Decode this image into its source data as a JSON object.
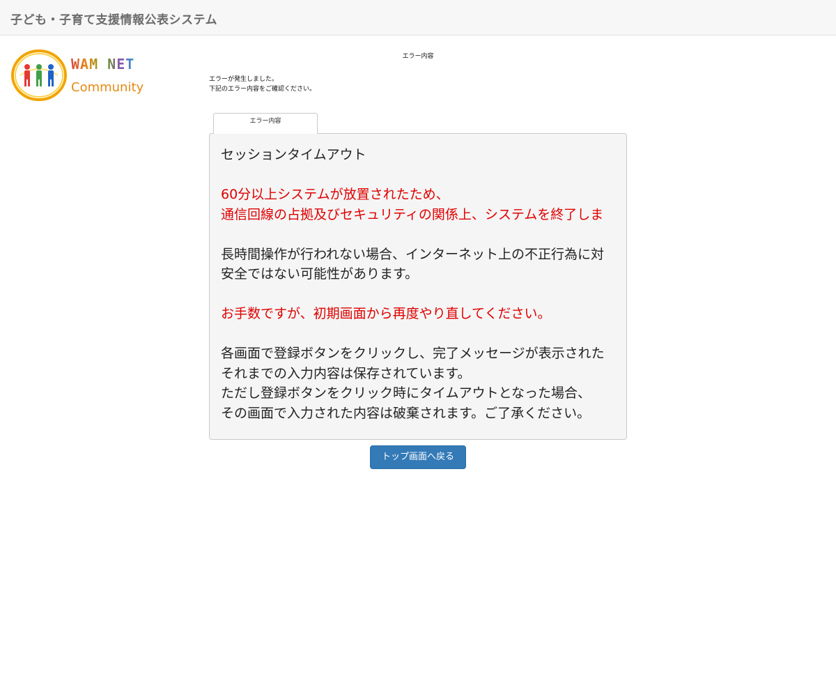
{
  "header": {
    "title": "子ども・子育て支援情報公表システム"
  },
  "logo": {
    "wordmark": "WAM NET",
    "subtitle": "Community",
    "colors": {
      "ring": "#f0a500",
      "figure_red": "#e53935",
      "figure_green": "#43a047",
      "figure_blue": "#1e63c8",
      "wordmark_gray": "#555555",
      "subtitle_orange": "#e58a14"
    }
  },
  "page": {
    "heading": "エラー内容",
    "intro_line1": "エラーが発生しました。",
    "intro_line2": "下記のエラー内容をご確認ください。"
  },
  "tab": {
    "label": "エラー内容"
  },
  "error": {
    "title": "セッションタイムアウト",
    "red_line1": "60分以上システムが放置されたため、",
    "red_line2": "通信回線の占拠及びセキュリティの関係上、システムを終了しま",
    "info_line1": "長時間操作が行われない場合、インターネット上の不正行為に対",
    "info_line2": "安全ではない可能性があります。",
    "apology": "お手数ですが、初期画面から再度やり直してください。",
    "note_line1": "各画面で登録ボタンをクリックし、完了メッセージが表示された",
    "note_line2": "それまでの入力内容は保存されています。",
    "note_line3": "ただし登録ボタンをクリック時にタイムアウトとなった場合、",
    "note_line4": "その画面で入力された内容は破棄されます。ご了承ください。",
    "red_color": "#e00000"
  },
  "actions": {
    "back_button": "トップ画面へ戻る",
    "button_color": "#337ab7"
  }
}
